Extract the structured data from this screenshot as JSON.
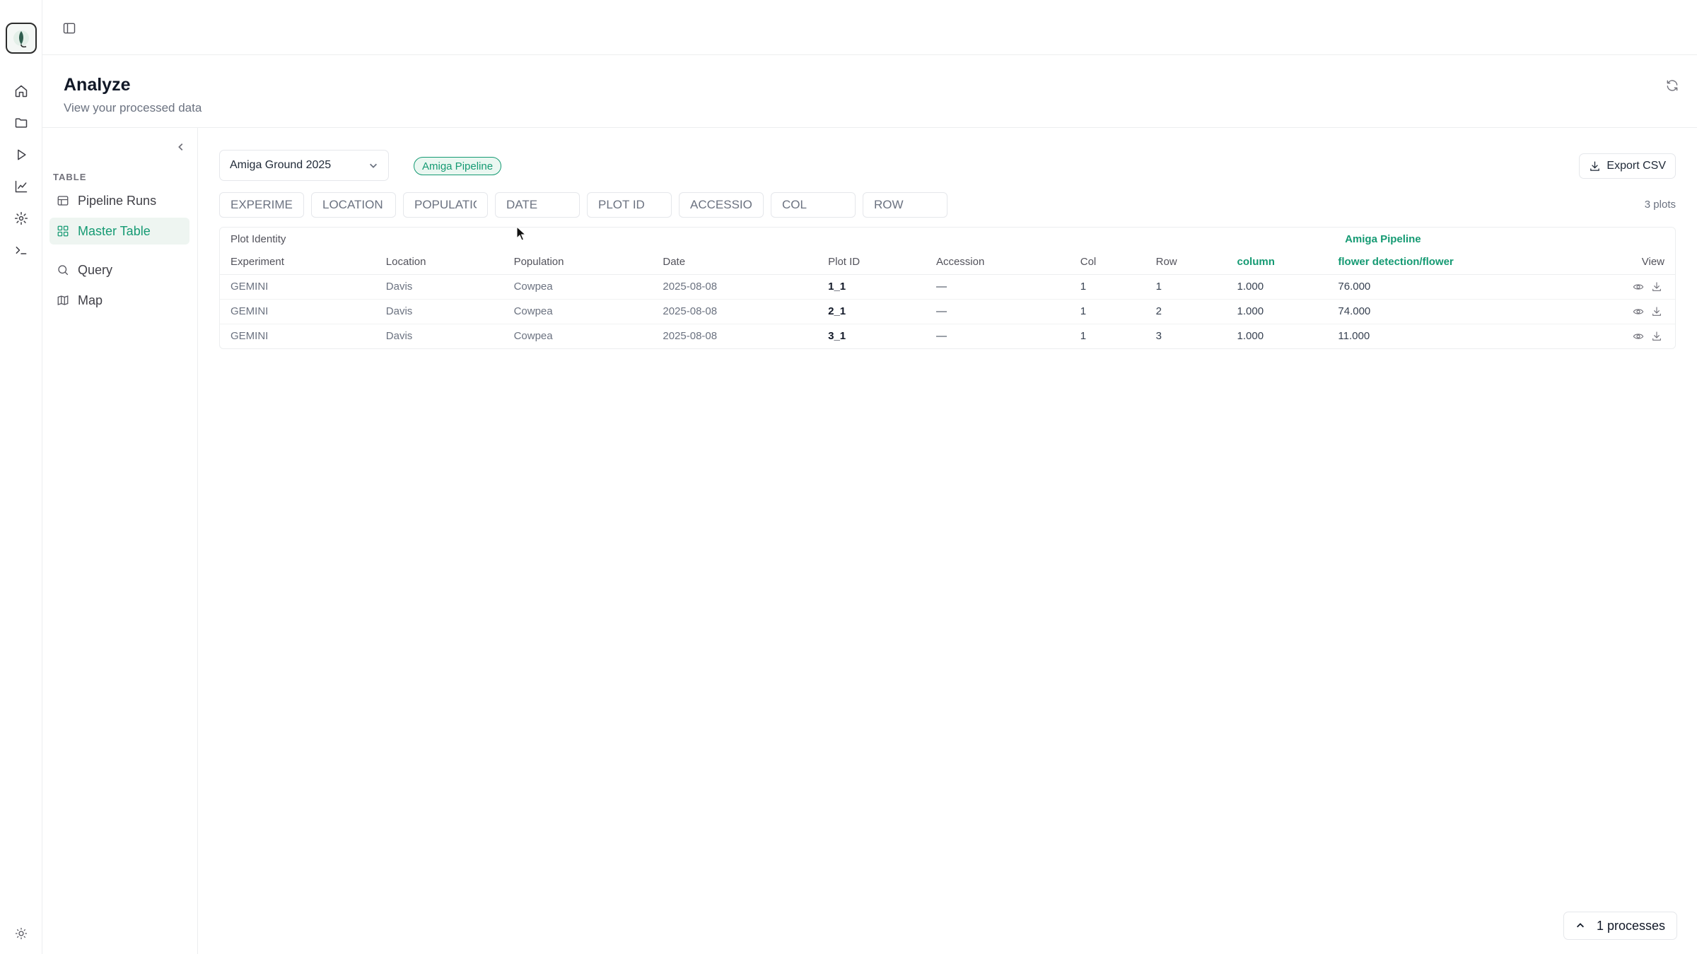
{
  "rail": {
    "items": [
      {
        "name": "home-icon"
      },
      {
        "name": "folder-icon"
      },
      {
        "name": "play-icon"
      },
      {
        "name": "chart-icon"
      },
      {
        "name": "gear-icon"
      },
      {
        "name": "terminal-icon"
      }
    ],
    "theme_icon": "sun-icon"
  },
  "page": {
    "title": "Analyze",
    "subtitle": "View your processed data"
  },
  "sidebar": {
    "section_label": "TABLE",
    "items": [
      {
        "label": "Pipeline Runs",
        "icon": "table-icon",
        "active": false
      },
      {
        "label": "Master Table",
        "icon": "grid-icon",
        "active": true
      },
      {
        "label": "Query",
        "icon": "search-icon",
        "active": false
      },
      {
        "label": "Map",
        "icon": "map-icon",
        "active": false
      }
    ]
  },
  "toolbar": {
    "dataset_select": "Amiga Ground 2025",
    "pipeline_badge": "Amiga Pipeline",
    "export_label": "Export CSV",
    "plot_count": "3 plots"
  },
  "filters": {
    "placeholders": [
      "EXPERIMENT",
      "LOCATION",
      "POPULATION",
      "DATE",
      "PLOT ID",
      "ACCESSION",
      "COL",
      "ROW"
    ]
  },
  "table": {
    "group_identity": "Plot Identity",
    "group_pipeline": "Amiga Pipeline",
    "headers": [
      "Experiment",
      "Location",
      "Population",
      "Date",
      "Plot ID",
      "Accession",
      "Col",
      "Row",
      "column",
      "flower detection/flower",
      "View"
    ],
    "rows": [
      {
        "experiment": "GEMINI",
        "location": "Davis",
        "population": "Cowpea",
        "date": "2025-08-08",
        "plot_id": "1_1",
        "accession": "—",
        "col": "1",
        "row": "1",
        "column": "1.000",
        "flower": "76.000"
      },
      {
        "experiment": "GEMINI",
        "location": "Davis",
        "population": "Cowpea",
        "date": "2025-08-08",
        "plot_id": "2_1",
        "accession": "—",
        "col": "1",
        "row": "2",
        "column": "1.000",
        "flower": "74.000"
      },
      {
        "experiment": "GEMINI",
        "location": "Davis",
        "population": "Cowpea",
        "date": "2025-08-08",
        "plot_id": "3_1",
        "accession": "—",
        "col": "1",
        "row": "3",
        "column": "1.000",
        "flower": "11.000"
      }
    ]
  },
  "processes": {
    "label": "1 processes"
  },
  "colors": {
    "accent": "#159a73",
    "accent_bg": "#eaf7f1"
  }
}
